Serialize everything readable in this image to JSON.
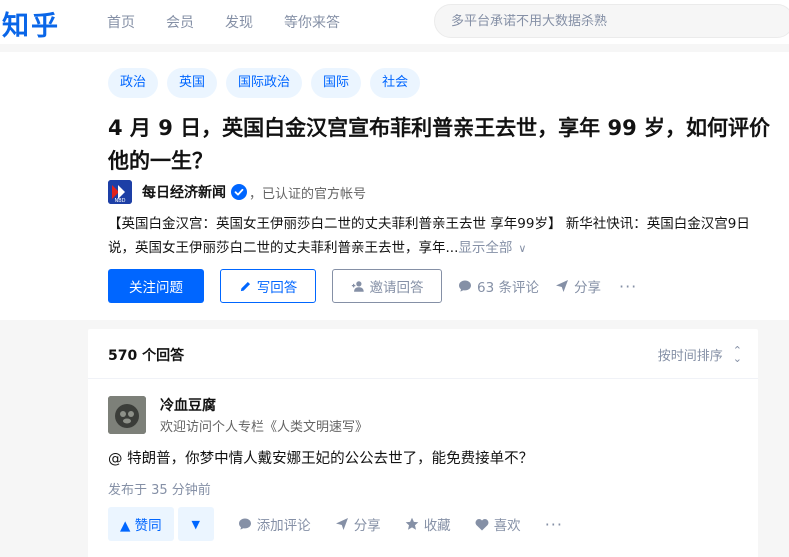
{
  "header": {
    "logo": "知乎",
    "nav": [
      "首页",
      "会员",
      "发现",
      "等你来答"
    ],
    "search_placeholder": "多平台承诺不用大数据杀熟"
  },
  "question": {
    "topics": [
      "政治",
      "英国",
      "国际政治",
      "国际",
      "社会"
    ],
    "title": "4 月 9 日，英国白金汉宫宣布菲利普亲王去世，享年 99 岁，如何评价他的一生？",
    "publisher": {
      "name": "每日经济新闻",
      "verified_text": "，已认证的官方帐号",
      "avatar_text": "NBD"
    },
    "excerpt": "【英国白金汉宫：英国女王伊丽莎白二世的丈夫菲利普亲王去世 享年99岁】 新华社快讯：英国白金汉宫9日说，英国女王伊丽莎白二世的丈夫菲利普亲王去世，享年...",
    "show_all": "显示全部",
    "actions": {
      "follow": "关注问题",
      "write_answer": "写回答",
      "invite": "邀请回答",
      "comments": "63 条评论",
      "share": "分享",
      "more": "···"
    }
  },
  "answers": {
    "count_label": "570 个回答",
    "sort_label": "按时间排序",
    "items": [
      {
        "author": "冷血豆腐",
        "bio": "欢迎访问个人专栏《人类文明速写》",
        "content": "@ 特朗普，你梦中情人戴安娜王妃的公公去世了，能免费接单不？",
        "time": "发布于 35 分钟前",
        "upvote": "▲ 赞同",
        "add_comment": "添加评论",
        "share": "分享",
        "favorite": "收藏",
        "like": "喜欢",
        "more": "···"
      }
    ]
  },
  "colors": {
    "brand": "#0066ff",
    "logo": "#0a66e8",
    "muted": "#8590a6",
    "tag_bg": "#ebf5ff"
  }
}
